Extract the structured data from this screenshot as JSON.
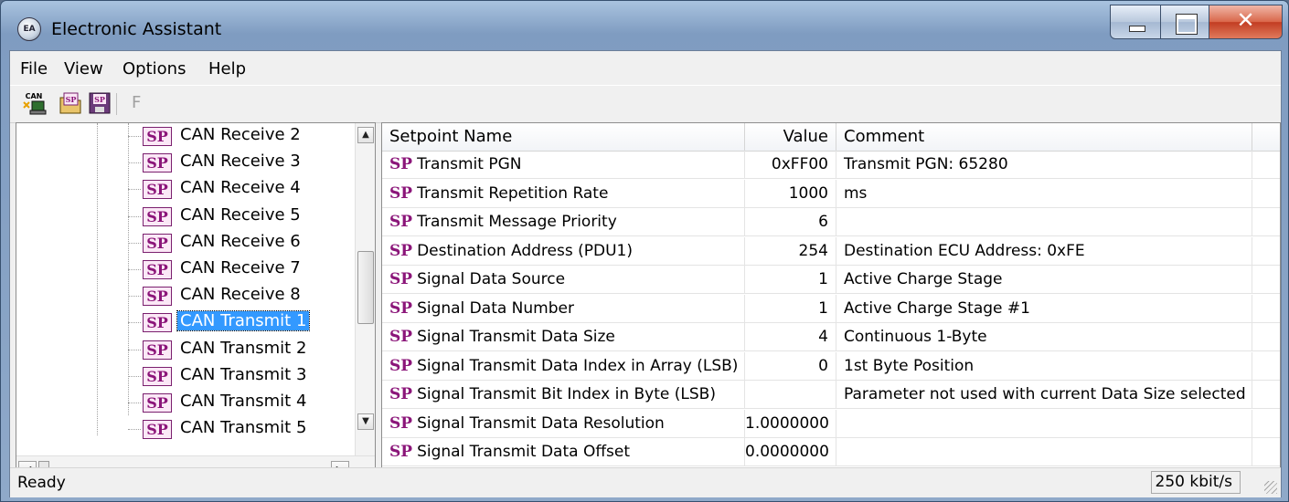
{
  "window": {
    "title": "Electronic Assistant",
    "icon_text": "EA"
  },
  "menu": [
    "File",
    "View",
    "Options",
    "Help"
  ],
  "toolbar": {
    "buttons": [
      {
        "icon": "can-connect-icon",
        "label": "CAN"
      },
      {
        "icon": "open-setpoint-file-icon",
        "label": "SP"
      },
      {
        "icon": "save-setpoint-file-icon",
        "label": "SP"
      }
    ],
    "disabled_label": "F"
  },
  "tree": {
    "badge": "SP",
    "items": [
      {
        "label": "CAN Receive 2",
        "selected": false
      },
      {
        "label": "CAN Receive 3",
        "selected": false
      },
      {
        "label": "CAN Receive 4",
        "selected": false
      },
      {
        "label": "CAN Receive 5",
        "selected": false
      },
      {
        "label": "CAN Receive 6",
        "selected": false
      },
      {
        "label": "CAN Receive 7",
        "selected": false
      },
      {
        "label": "CAN Receive 8",
        "selected": false
      },
      {
        "label": "CAN Transmit 1",
        "selected": true
      },
      {
        "label": "CAN Transmit 2",
        "selected": false
      },
      {
        "label": "CAN Transmit 3",
        "selected": false
      },
      {
        "label": "CAN Transmit 4",
        "selected": false
      },
      {
        "label": "CAN Transmit 5",
        "selected": false
      }
    ]
  },
  "grid": {
    "columns": {
      "name": "Setpoint Name",
      "value": "Value",
      "comment": "Comment"
    },
    "badge": "SP",
    "rows": [
      {
        "name": "Transmit PGN",
        "value": "0xFF00",
        "comment": "Transmit PGN: 65280"
      },
      {
        "name": "Transmit Repetition Rate",
        "value": "1000",
        "comment": "ms"
      },
      {
        "name": "Transmit Message Priority",
        "value": "6",
        "comment": ""
      },
      {
        "name": "Destination Address (PDU1)",
        "value": "254",
        "comment": "Destination ECU Address: 0xFE"
      },
      {
        "name": "Signal Data Source",
        "value": "1",
        "comment": "Active Charge Stage"
      },
      {
        "name": "Signal Data Number",
        "value": "1",
        "comment": "Active Charge Stage #1"
      },
      {
        "name": "Signal Transmit Data Size",
        "value": "4",
        "comment": "Continuous 1-Byte"
      },
      {
        "name": "Signal Transmit Data Index in Array (LSB)",
        "value": "0",
        "comment": "1st Byte Position"
      },
      {
        "name": "Signal Transmit Bit Index in Byte (LSB)",
        "value": "",
        "comment": "Parameter not used with current Data Size selected"
      },
      {
        "name": "Signal Transmit Data Resolution",
        "value": "1.0000000",
        "comment": ""
      },
      {
        "name": "Signal Transmit Data Offset",
        "value": "0.0000000",
        "comment": ""
      }
    ]
  },
  "status": {
    "text": "Ready",
    "baud": "250 kbit/s"
  }
}
